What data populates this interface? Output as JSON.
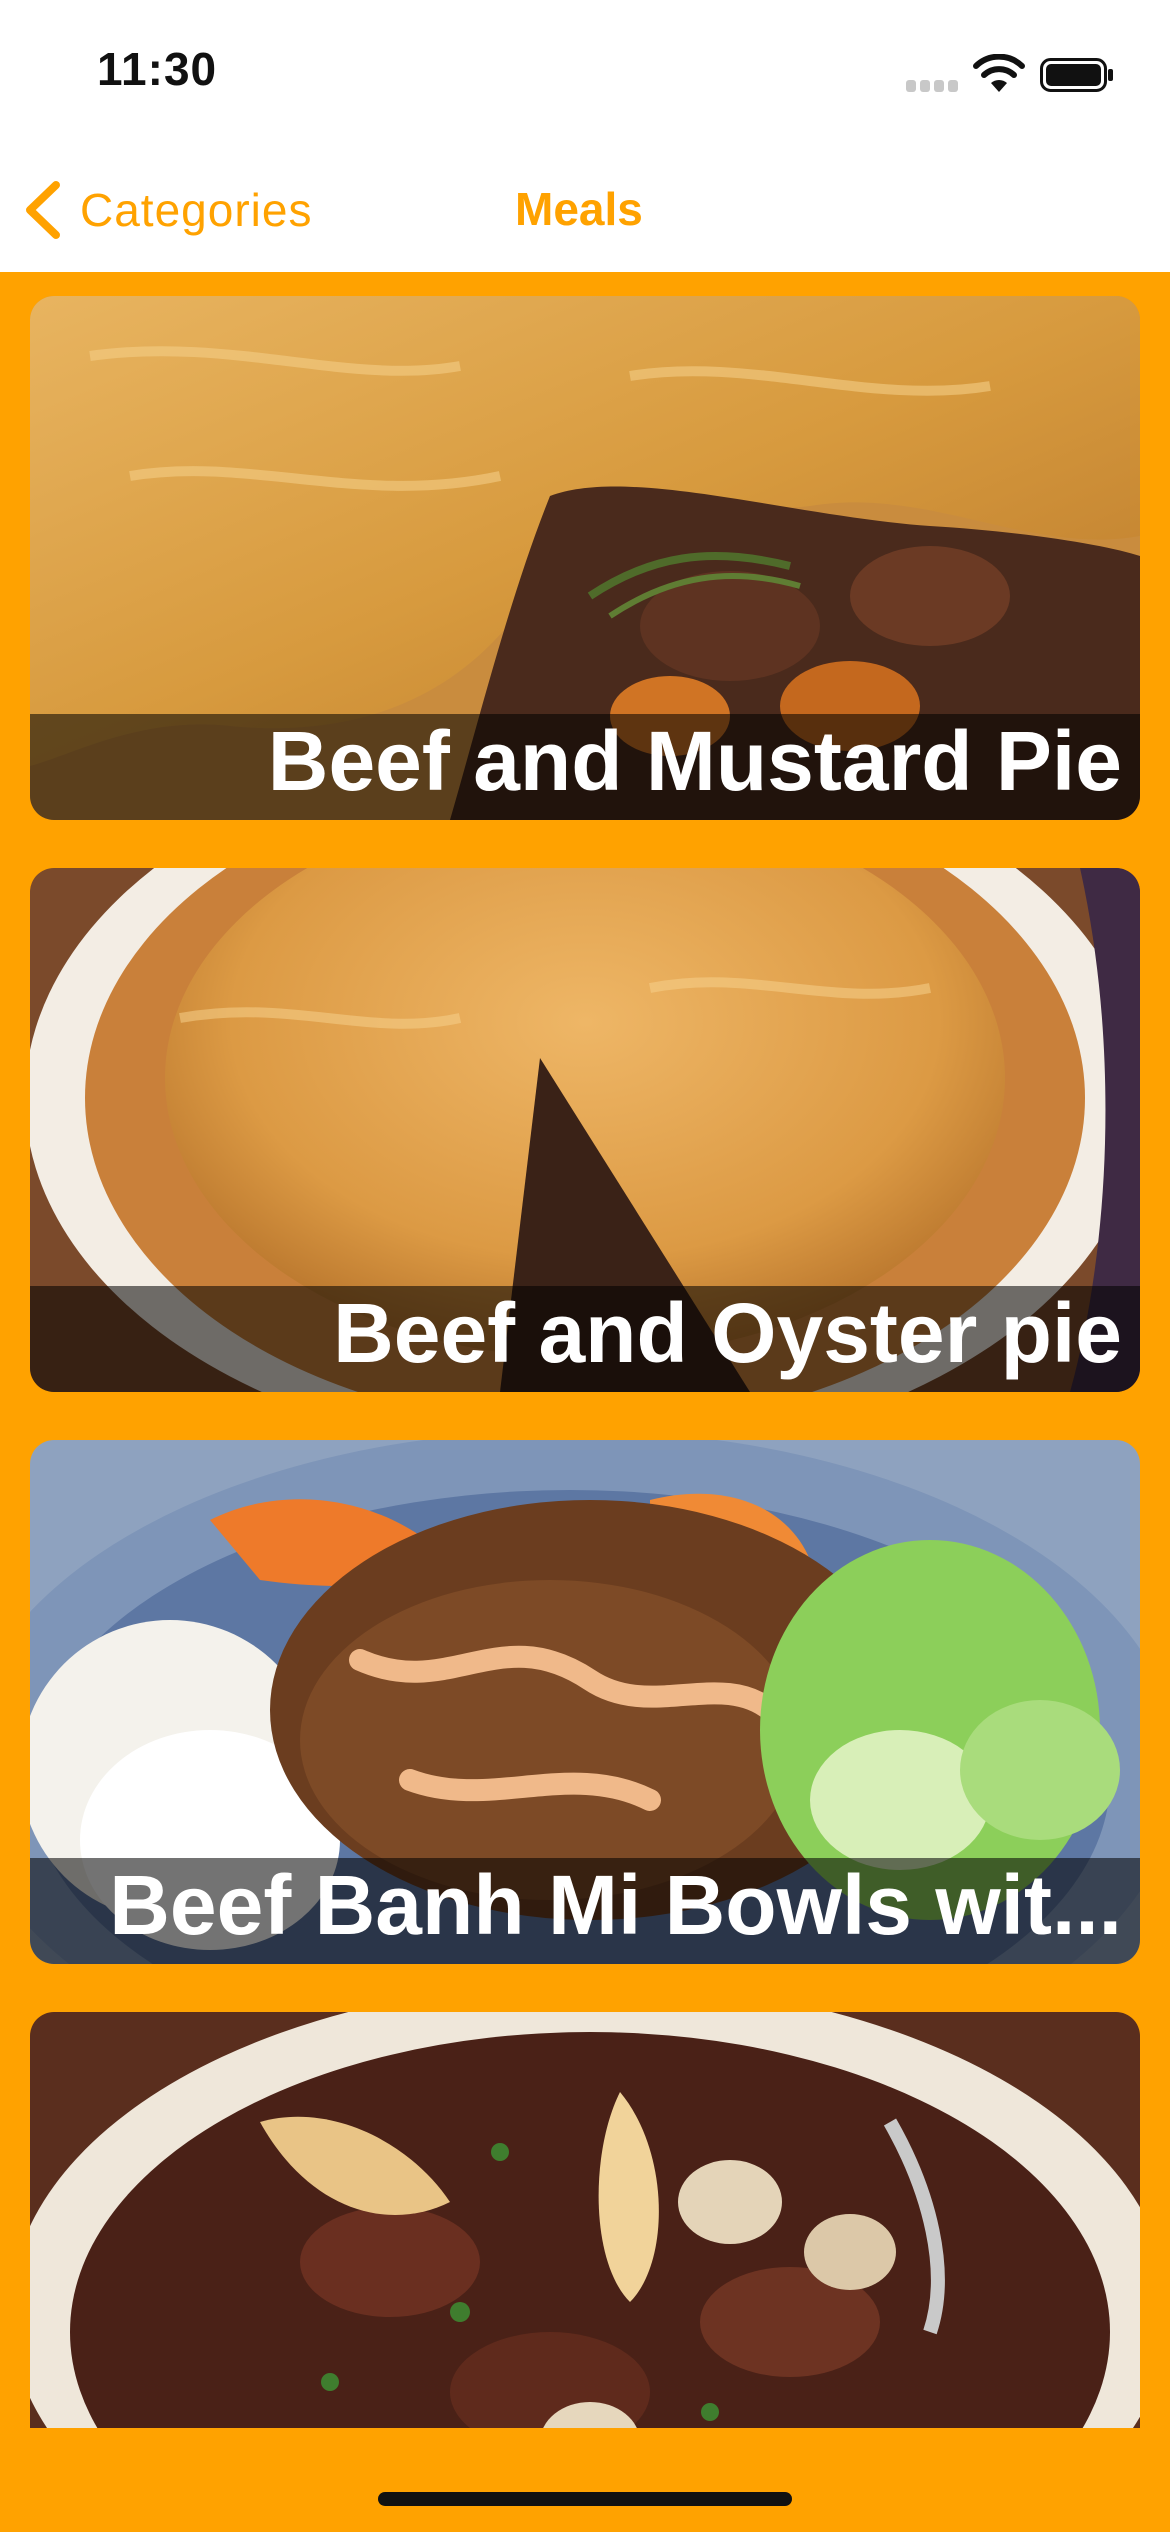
{
  "status_bar": {
    "time": "11:30",
    "icons": [
      "cellular-signal-icon",
      "wifi-icon",
      "battery-icon"
    ]
  },
  "nav": {
    "back_label": "Categories",
    "title": "Meals",
    "back_icon": "chevron-left-icon"
  },
  "theme": {
    "accent": "#FFA200",
    "title_bar_overlay": "rgba(0,0,0,0.55)"
  },
  "meals": [
    {
      "title": "Beef and Mustard Pie",
      "image": "beef-mustard-pie-photo"
    },
    {
      "title": "Beef and Oyster pie",
      "image": "beef-oyster-pie-photo"
    },
    {
      "title": "Beef Banh Mi Bowls wit...",
      "image": "beef-banh-mi-bowl-photo"
    },
    {
      "title": "",
      "image": "beef-bourguignon-photo"
    }
  ]
}
